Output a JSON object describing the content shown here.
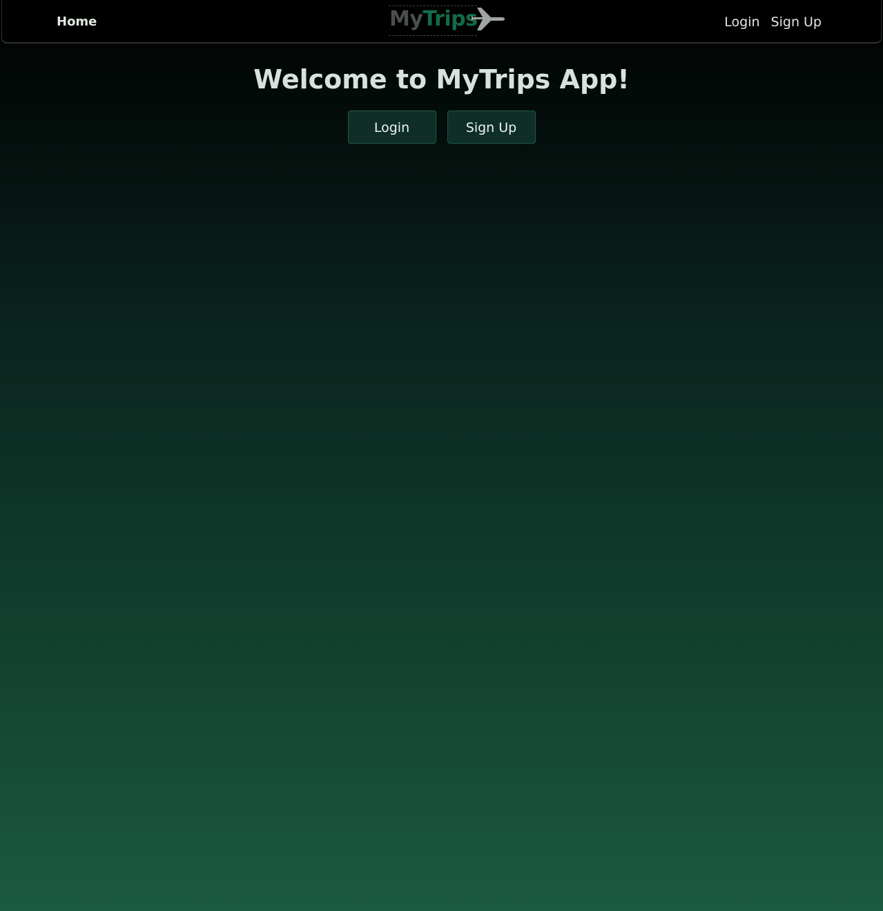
{
  "navbar": {
    "home_label": "Home",
    "logo": {
      "part1": "My",
      "part2": "Trips",
      "icon": "airplane-icon"
    },
    "login_label": "Login",
    "signup_label": "Sign Up"
  },
  "main": {
    "heading": "Welcome to MyTrips App!",
    "login_button": "Login",
    "signup_button": "Sign Up"
  },
  "colors": {
    "logo_my": "#4a4e4c",
    "logo_trips": "#136b47",
    "button_bg": "#0e2e27",
    "background_bottom": "#1a5a40"
  }
}
